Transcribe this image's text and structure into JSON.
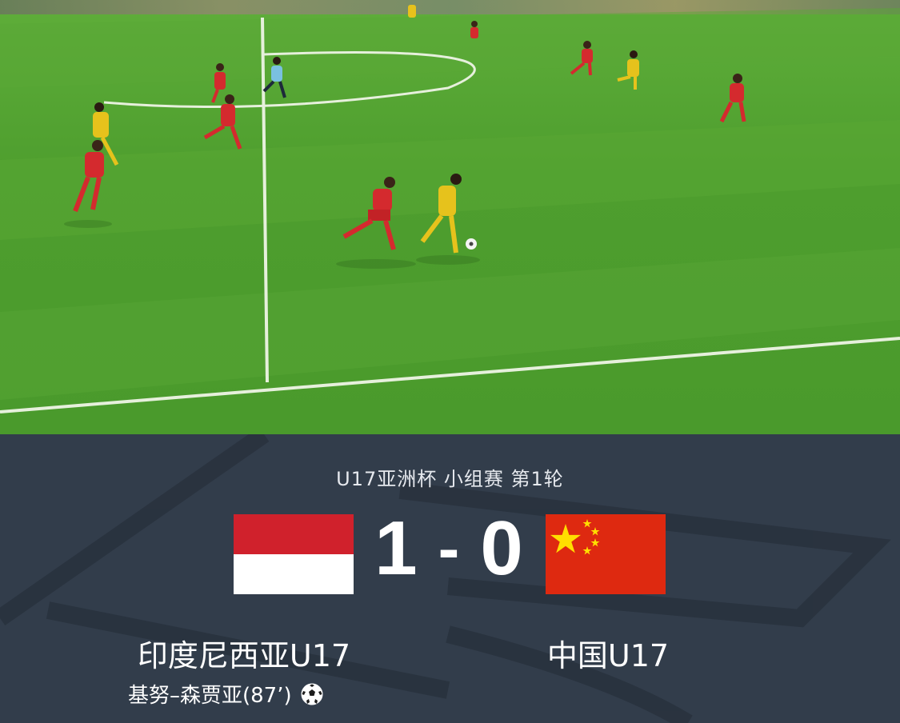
{
  "match": {
    "title": "U17亚洲杯 小组赛 第1轮",
    "home_team": "印度尼西亚U17",
    "away_team": "中国U17",
    "home_score": "1",
    "separator": "-",
    "away_score": "0",
    "scorer": "基努–森贾亚(87’)",
    "scorer_icon": "soccer-ball-icon"
  },
  "colors": {
    "board_bg": "#323d4b",
    "indonesia_red": "#d0212c",
    "china_red": "#de2910",
    "china_star": "#ffde00"
  }
}
